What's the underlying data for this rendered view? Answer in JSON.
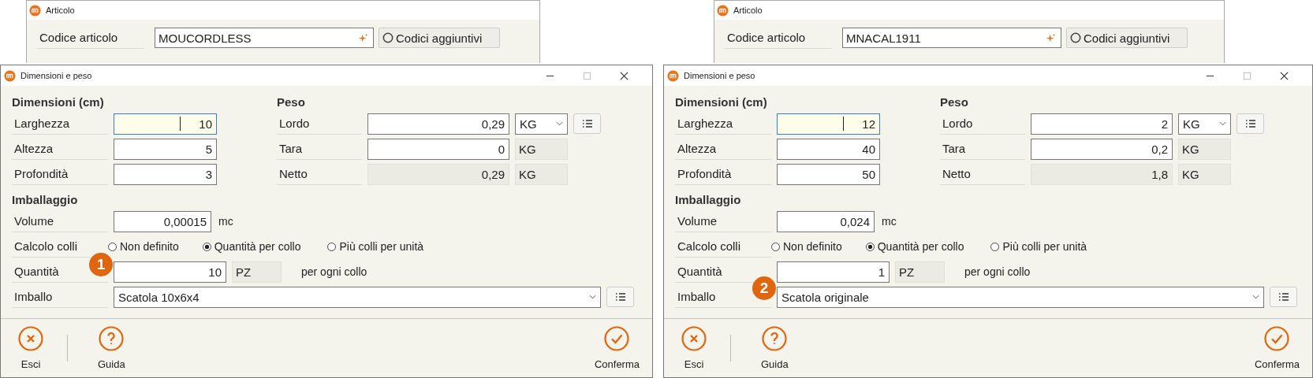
{
  "panels": [
    {
      "article_window": {
        "title": "Articolo",
        "code_label": "Codice articolo",
        "code_value": "MOUCORDLESS",
        "extra_codes_button": "Codici aggiuntivi"
      },
      "dialog": {
        "title": "Dimensioni e peso",
        "dimensions": {
          "heading": "Dimensioni (cm)",
          "rows": [
            {
              "label": "Larghezza",
              "value": "10",
              "focused": true
            },
            {
              "label": "Altezza",
              "value": "5",
              "focused": false
            },
            {
              "label": "Profondità",
              "value": "3",
              "focused": false
            }
          ]
        },
        "weight": {
          "heading": "Peso",
          "rows": [
            {
              "kind": "dropdown",
              "label": "Lordo",
              "value": "0,29",
              "unit": "KG"
            },
            {
              "kind": "fixed",
              "label": "Tara",
              "value": "0",
              "unit": "KG"
            },
            {
              "kind": "computed",
              "label": "Netto",
              "value": "0,29",
              "unit": "KG"
            }
          ]
        },
        "packaging": {
          "heading": "Imballaggio",
          "volume": {
            "label": "Volume",
            "value": "0,00015",
            "unit": "mc"
          },
          "colli": {
            "label": "Calcolo colli",
            "options": [
              {
                "label": "Non definito",
                "selected": false
              },
              {
                "label": "Quantità per collo",
                "selected": true
              },
              {
                "label": "Più colli per unità",
                "selected": false
              }
            ]
          },
          "quantity": {
            "label": "Quantità",
            "value": "10",
            "unit": "PZ",
            "suffix": "per ogni collo"
          },
          "packing": {
            "label": "Imballo",
            "value": "Scatola 10x6x4"
          }
        },
        "badge": "1",
        "buttons": [
          {
            "kind": "cancel",
            "label": "Esci"
          },
          {
            "kind": "help",
            "label": "Guida"
          },
          {
            "kind": "confirm",
            "label": "Conferma"
          }
        ]
      }
    },
    {
      "article_window": {
        "title": "Articolo",
        "code_label": "Codice articolo",
        "code_value": "MNACAL1911",
        "extra_codes_button": "Codici aggiuntivi"
      },
      "dialog": {
        "title": "Dimensioni e peso",
        "dimensions": {
          "heading": "Dimensioni (cm)",
          "rows": [
            {
              "label": "Larghezza",
              "value": "12",
              "focused": true
            },
            {
              "label": "Altezza",
              "value": "40",
              "focused": false
            },
            {
              "label": "Profondità",
              "value": "50",
              "focused": false
            }
          ]
        },
        "weight": {
          "heading": "Peso",
          "rows": [
            {
              "kind": "dropdown",
              "label": "Lordo",
              "value": "2",
              "unit": "KG"
            },
            {
              "kind": "fixed",
              "label": "Tara",
              "value": "0,2",
              "unit": "KG"
            },
            {
              "kind": "computed",
              "label": "Netto",
              "value": "1,8",
              "unit": "KG"
            }
          ]
        },
        "packaging": {
          "heading": "Imballaggio",
          "volume": {
            "label": "Volume",
            "value": "0,024",
            "unit": "mc"
          },
          "colli": {
            "label": "Calcolo colli",
            "options": [
              {
                "label": "Non definito",
                "selected": false
              },
              {
                "label": "Quantità per collo",
                "selected": true
              },
              {
                "label": "Più colli per unità",
                "selected": false
              }
            ]
          },
          "quantity": {
            "label": "Quantità",
            "value": "1",
            "unit": "PZ",
            "suffix": "per ogni collo"
          },
          "packing": {
            "label": "Imballo",
            "value": "Scatola originale"
          }
        },
        "badge": "2",
        "buttons": [
          {
            "kind": "cancel",
            "label": "Esci"
          },
          {
            "kind": "help",
            "label": "Guida"
          },
          {
            "kind": "confirm",
            "label": "Conferma"
          }
        ]
      }
    }
  ]
}
